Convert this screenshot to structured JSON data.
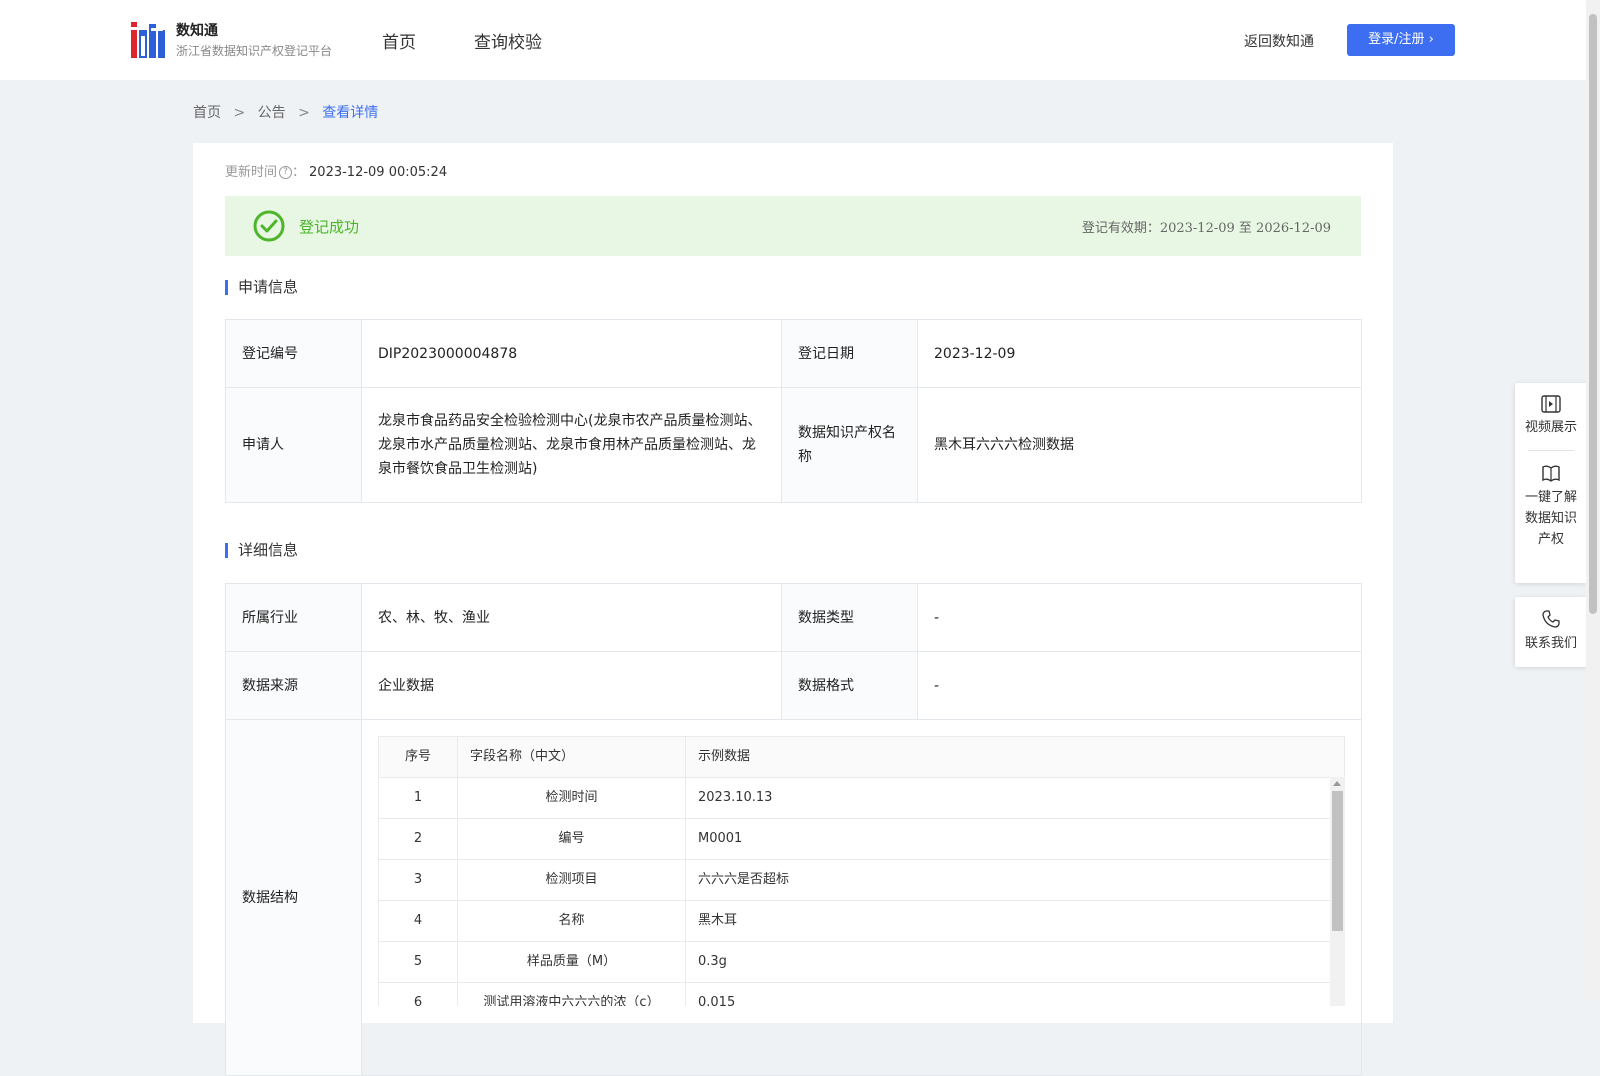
{
  "header": {
    "brand_name": "数知通",
    "brand_sub": "浙江省数据知识产权登记平台",
    "nav": [
      "首页",
      "查询校验"
    ],
    "back_link": "返回数知通",
    "login_button": "登录/注册"
  },
  "breadcrumb": [
    "首页",
    "公告",
    "查看详情"
  ],
  "update": {
    "label": "更新时间",
    "value": "2023-12-09 00:05:24"
  },
  "status": {
    "text": "登记成功",
    "validity_label": "登记有效期：",
    "validity_dates": "2023-12-09 至 2026-12-09"
  },
  "apply_section": {
    "title": "申请信息",
    "reg_no_label": "登记编号",
    "reg_no": "DIP2023000004878",
    "reg_date_label": "登记日期",
    "reg_date": "2023-12-09",
    "applicant_label": "申请人",
    "applicant": "龙泉市食品药品安全检验检测中心(龙泉市农产品质量检测站、龙泉市水产品质量检测站、龙泉市食用林产品质量检测站、龙泉市餐饮食品卫生检测站)",
    "ip_name_label": "数据知识产权名称",
    "ip_name": "黑木耳六六六检测数据"
  },
  "detail_section": {
    "title": "详细信息",
    "industry_label": "所属行业",
    "industry": "农、林、牧、渔业",
    "data_type_label": "数据类型",
    "data_type": "-",
    "source_label": "数据来源",
    "source": "企业数据",
    "format_label": "数据格式",
    "format": "-",
    "structure_label": "数据结构"
  },
  "structure_table": {
    "headers": [
      "序号",
      "字段名称（中文）",
      "示例数据"
    ],
    "rows": [
      [
        "1",
        "检测时间",
        "2023.10.13"
      ],
      [
        "2",
        "编号",
        "M0001"
      ],
      [
        "3",
        "检测项目",
        "六六六是否超标"
      ],
      [
        "4",
        "名称",
        "黑木耳"
      ],
      [
        "5",
        "样品质量（M）",
        "0.3g"
      ],
      [
        "6",
        "测试用溶液中六六六的浓（c）",
        "0.015"
      ]
    ]
  },
  "side_panel": {
    "video": "视频展示",
    "learn": "一键了解数据知识产权",
    "contact": "联系我们"
  },
  "colors": {
    "primary": "#3d6ef2",
    "success": "#4cb52a",
    "success_bg": "#e8f7e4"
  }
}
